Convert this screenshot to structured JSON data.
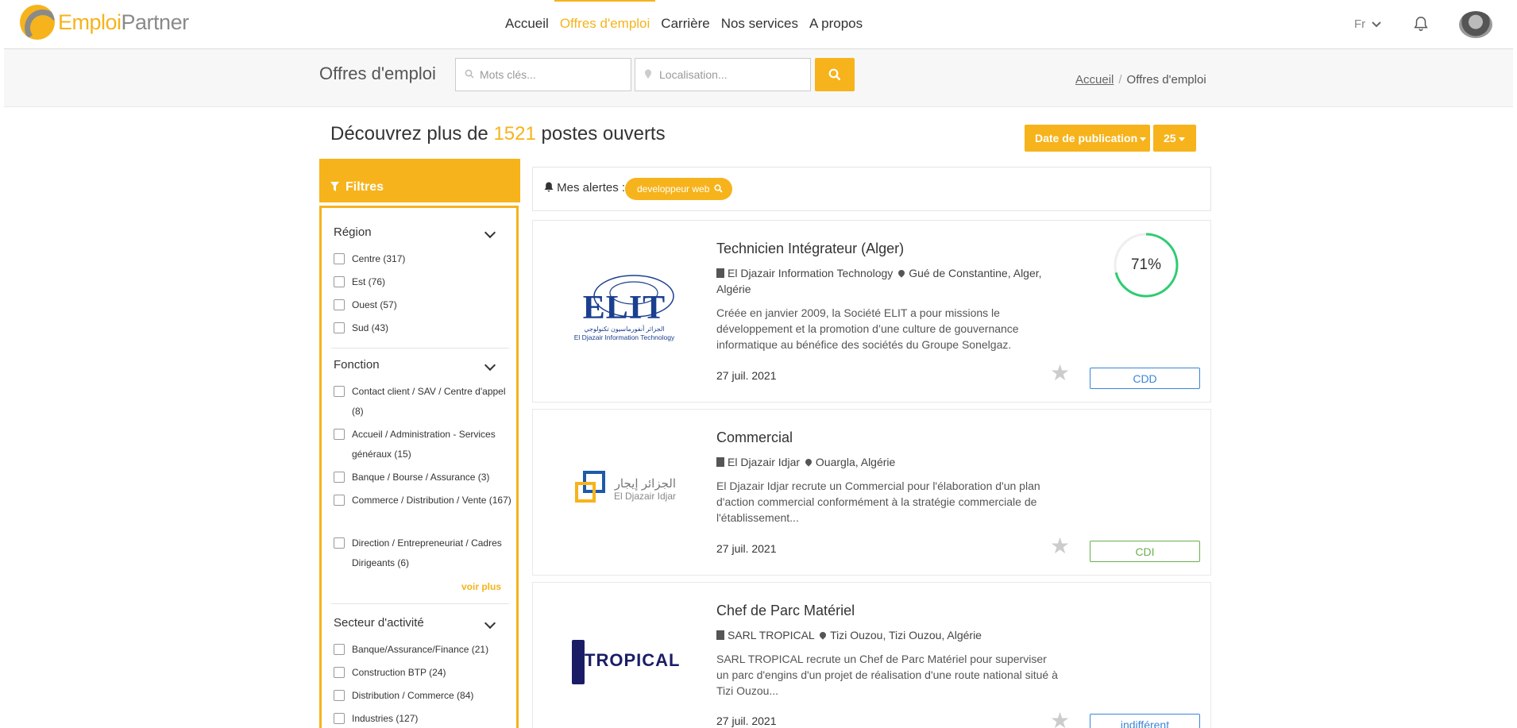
{
  "brand": {
    "part1": "Emploi",
    "part2": "Partner"
  },
  "nav": {
    "items": [
      {
        "label": "Accueil"
      },
      {
        "label": "Offres d'emploi"
      },
      {
        "label": "Carrière"
      },
      {
        "label": "Nos services"
      },
      {
        "label": "A propos"
      }
    ],
    "lang": "Fr"
  },
  "search": {
    "page_title": "Offres d'emploi",
    "keywords_placeholder": "Mots clés...",
    "location_placeholder": "Localisation...",
    "breadcrumb": {
      "home": "Accueil",
      "sep": "/",
      "current": "Offres d'emploi"
    }
  },
  "headline": {
    "prefix": "Découvrez plus de",
    "count": "1521",
    "suffix": "postes ouverts"
  },
  "sort": {
    "label": "Date de publication",
    "per_page": "25"
  },
  "filters": {
    "title": "Filtres",
    "region": {
      "title": "Région",
      "items": [
        "Centre (317)",
        "Est (76)",
        "Ouest (57)",
        "Sud (43)"
      ]
    },
    "fonction": {
      "title": "Fonction",
      "items": [
        "Contact client / SAV / Centre d'appel (8)",
        "Accueil / Administration - Services généraux (15)",
        "Banque / Bourse / Assurance (3)",
        "Commerce / Distribution / Vente (167)",
        "Direction / Entrepreneuriat / Cadres Dirigeants (6)"
      ],
      "more": "voir plus"
    },
    "secteur": {
      "title": "Secteur d'activité",
      "items": [
        "Banque/Assurance/Finance (21)",
        "Construction BTP (24)",
        "Distribution / Commerce (84)",
        "Industries (127)"
      ]
    }
  },
  "alerts": {
    "label": "Mes alertes :",
    "tag": "developpeur web"
  },
  "jobs": [
    {
      "title": "Technicien Intégrateur (Alger)",
      "company": "El Djazair Information Technology",
      "location": "Gué de Constantine, Alger, Algérie",
      "description": "Créée en janvier 2009, la Société ELIT a pour missions le développement et la promotion d’une culture de gouvernance informatique au bénéfice des sociétés du Groupe Sonelgaz.",
      "date": "27 juil. 2021",
      "contract": "CDD",
      "match": "71%",
      "match_value": 0.71,
      "logo": {
        "main": "ELIT",
        "arabic": "الجزائر أنفورماسيون تكنولوجي",
        "sub": "El Djazair Information Technology"
      }
    },
    {
      "title": "Commercial",
      "company": "El Djazair Idjar",
      "location": "Ouargla, Algérie",
      "description": "El Djazair Idjar recrute un Commercial pour l'élaboration d'un plan d'action commercial conformément à la stratégie commerciale de l'établissement...",
      "date": "27 juil. 2021",
      "contract": "CDI",
      "logo": {
        "arabic": "الجزائر إيجار",
        "sub": "El Djazair Idjar"
      }
    },
    {
      "title": "Chef de Parc Matériel",
      "company": "SARL TROPICAL",
      "location": "Tizi Ouzou, Tizi Ouzou, Algérie",
      "description": "SARL TROPICAL recrute un Chef de Parc Matériel pour superviser un parc d'engins d'un projet de réalisation d'une route national situé à Tizi Ouzou...",
      "date": "27 juil. 2021",
      "contract": "indifférent",
      "logo": {
        "main": "TROPICAL"
      }
    }
  ],
  "colors": {
    "accent": "#f6b31b",
    "cdd": "#3a86d8",
    "cdi": "#6ab04c",
    "match": "#2ecc71"
  }
}
